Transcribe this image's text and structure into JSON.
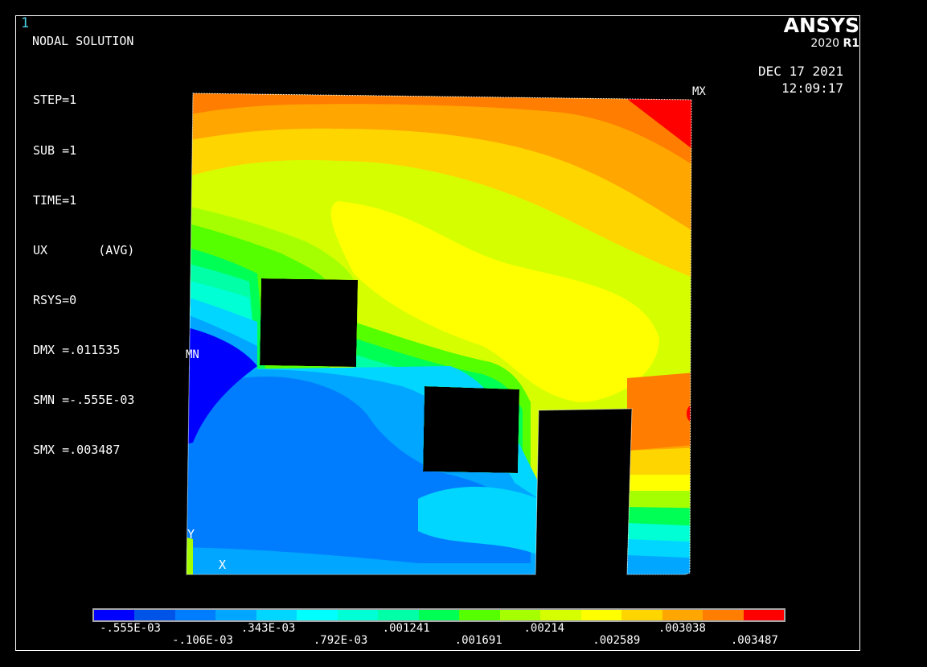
{
  "window_number": "1",
  "title": "NODAL SOLUTION",
  "params": [
    "STEP=1",
    "SUB =1",
    "TIME=1",
    "UX       (AVG)",
    "RSYS=0",
    "DMX =.011535",
    "SMN =-.555E-03",
    "SMX =.003487"
  ],
  "logo": {
    "brand": "ANSYS",
    "version_year": "2020",
    "version_release": "R1"
  },
  "date": "DEC 17 2021",
  "time": "12:09:17",
  "markers": {
    "max": "MX",
    "min": "MN",
    "axis_y": "Y",
    "axis_x": "X"
  },
  "legend": {
    "colors": [
      "#0000ff",
      "#0055e8",
      "#007dff",
      "#00a6ff",
      "#00d6ff",
      "#00ffff",
      "#00ffd5",
      "#00ffa6",
      "#00ff55",
      "#55ff00",
      "#a6ff00",
      "#d5ff00",
      "#ffff00",
      "#ffd500",
      "#ffa600",
      "#ff7d00",
      "#ff0000"
    ],
    "labels_lower": [
      "-.555E-03",
      ".343E-03",
      ".001241",
      ".00214",
      ".003038"
    ],
    "labels_upper": [
      "-.106E-03",
      ".792E-03",
      ".001691",
      ".002589",
      ".003487"
    ]
  },
  "chart_data": {
    "type": "heatmap",
    "quantity": "UX",
    "min": -0.000555,
    "max": 0.003487,
    "levels": [
      -0.000555,
      -0.000106,
      0.000343,
      0.000792,
      0.001241,
      0.001691,
      0.00214,
      0.002589,
      0.003038,
      0.003487
    ]
  }
}
